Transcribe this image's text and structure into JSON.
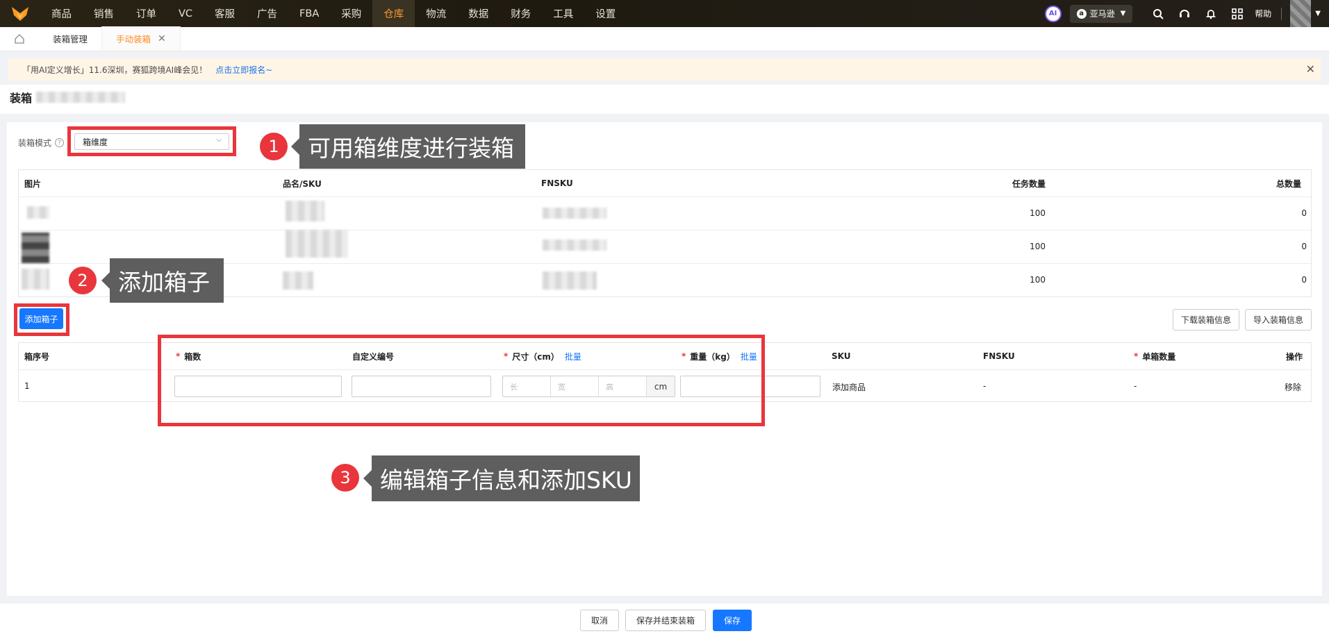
{
  "nav": {
    "items": [
      "商品",
      "销售",
      "订单",
      "VC",
      "客服",
      "广告",
      "FBA",
      "采购",
      "仓库",
      "物流",
      "数据",
      "财务",
      "工具",
      "设置"
    ],
    "active_index": 8,
    "ai_label": "AI",
    "store_label": "亚马逊",
    "help_label": "帮助"
  },
  "tabs": {
    "items": [
      "装箱管理",
      "手动装箱"
    ],
    "active_index": 1
  },
  "banner": {
    "text": "「用AI定义增长」11.6深圳，赛狐跨境AI峰会见！",
    "link": "点击立即报名~"
  },
  "page": {
    "title": "装箱"
  },
  "mode": {
    "label": "装箱模式",
    "value": "箱维度"
  },
  "annotations": [
    {
      "num": "1",
      "text": "可用箱维度进行装箱"
    },
    {
      "num": "2",
      "text": "添加箱子"
    },
    {
      "num": "3",
      "text": "编辑箱子信息和添加SKU"
    }
  ],
  "product_table": {
    "headers": [
      "图片",
      "品名/SKU",
      "FNSKU",
      "任务数量",
      "总数量"
    ],
    "rows": [
      {
        "task_qty": "100",
        "total_qty": "0"
      },
      {
        "task_qty": "100",
        "total_qty": "0"
      },
      {
        "task_qty": "100",
        "total_qty": "0"
      }
    ]
  },
  "actions": {
    "add_box": "添加箱子",
    "download": "下载装箱信息",
    "import": "导入装箱信息"
  },
  "box_table": {
    "headers": {
      "seq": "箱序号",
      "box_count": "箱数",
      "custom_no": "自定义编号",
      "size": "尺寸（cm）",
      "size_bulk": "批量",
      "weight": "重量（kg）",
      "weight_bulk": "批量",
      "sku": "SKU",
      "fnsku": "FNSKU",
      "per_box_qty": "单箱数量",
      "op": "操作"
    },
    "row": {
      "seq": "1",
      "len_placeholder": "长",
      "wid_placeholder": "宽",
      "hei_placeholder": "高",
      "unit": "cm",
      "add_product": "添加商品",
      "fnsku": "-",
      "per_box_qty": "-",
      "remove": "移除"
    }
  },
  "footer": {
    "cancel": "取消",
    "save_finish": "保存并结束装箱",
    "save": "保存"
  },
  "colors": {
    "accent_orange": "#ff8a1f",
    "primary_blue": "#1677ff",
    "annotation_red": "#e8363c",
    "callout_gray": "#5e5e5e"
  }
}
